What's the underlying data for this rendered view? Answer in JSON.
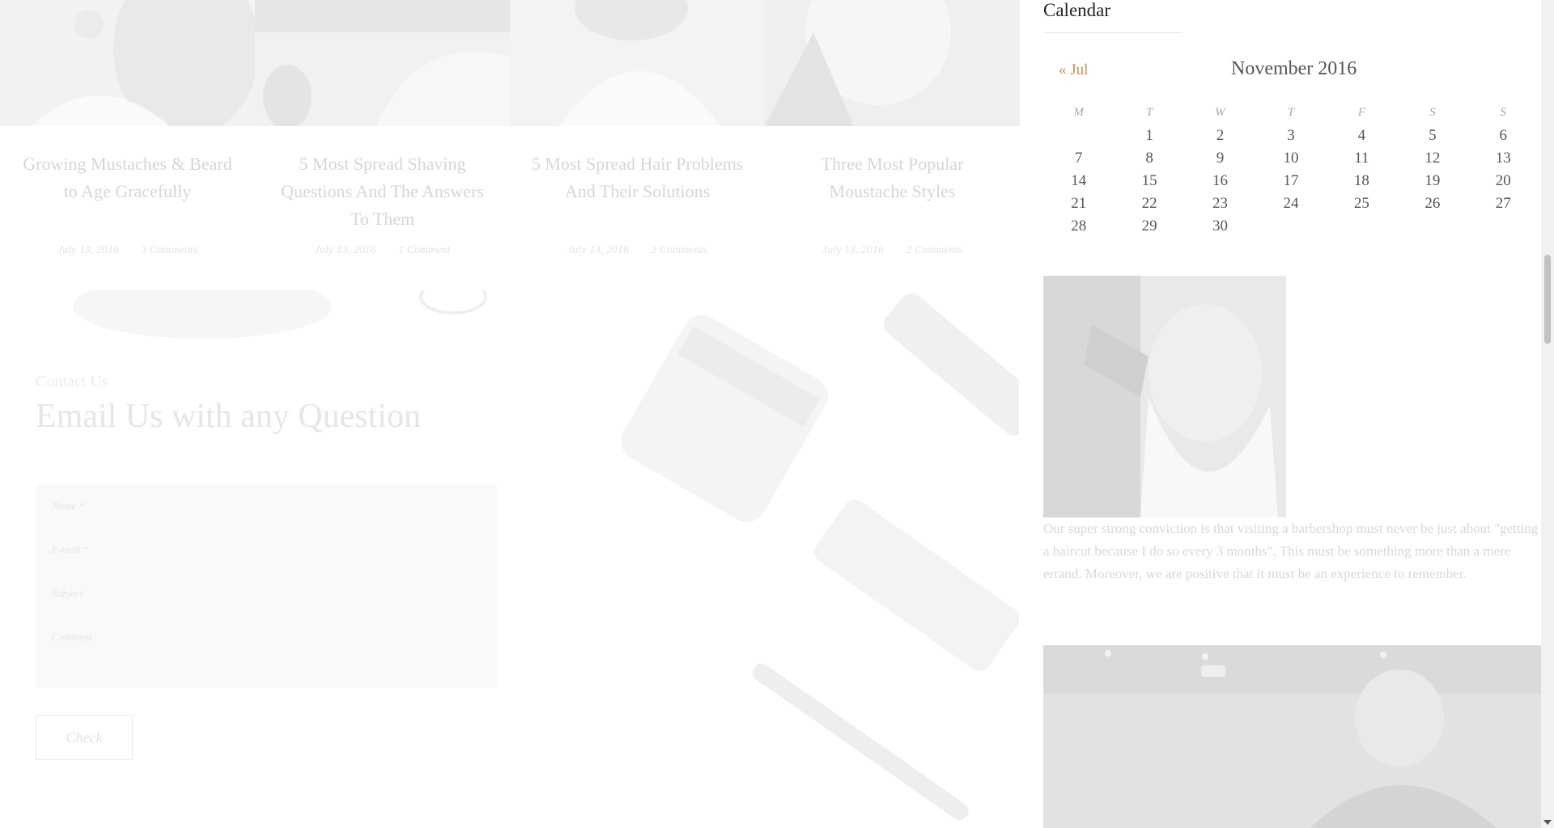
{
  "posts": [
    {
      "title": "Growing Mustaches & Beard to Age Gracefully",
      "date": "July 13, 2016",
      "comments": "3 Comments"
    },
    {
      "title": "5 Most Spread Shaving Questions And The Answers To Them",
      "date": "July 13, 2016",
      "comments": "1 Comment"
    },
    {
      "title": "5 Most Spread Hair Problems And Their Solutions",
      "date": "July 13, 2016",
      "comments": "2 Comments"
    },
    {
      "title": "Three Most Popular Moustache Styles",
      "date": "July 13, 2016",
      "comments": "2 Comments"
    }
  ],
  "contact": {
    "eyebrow": "Contact Us",
    "heading": "Email Us with any Question",
    "fields": {
      "name": "Name *",
      "email": "E-mail *",
      "subject": "Subject",
      "comment": "Comment"
    },
    "submit_label": "Check"
  },
  "sidebar": {
    "calendar_title": "Calendar",
    "prev_link": "« Jul",
    "caption": "November 2016",
    "weekdays": [
      "M",
      "T",
      "W",
      "T",
      "F",
      "S",
      "S"
    ],
    "weeks": [
      [
        "",
        "1",
        "2",
        "3",
        "4",
        "5",
        "6"
      ],
      [
        "7",
        "8",
        "9",
        "10",
        "11",
        "12",
        "13"
      ],
      [
        "14",
        "15",
        "16",
        "17",
        "18",
        "19",
        "20"
      ],
      [
        "21",
        "22",
        "23",
        "24",
        "25",
        "26",
        "27"
      ],
      [
        "28",
        "29",
        "30",
        "",
        "",
        "",
        ""
      ]
    ],
    "about_text": "Our super strong conviction is that visiting a barbershop must never be just about \"getting a haircut because I do so every 3 months\". This must be something more than a mere errand. Moreover, we are positive that it must be an experience to remember."
  },
  "colors": {
    "accent": "#c8904e",
    "text_dark": "#222222",
    "faded_text": "#d6d6d6"
  }
}
